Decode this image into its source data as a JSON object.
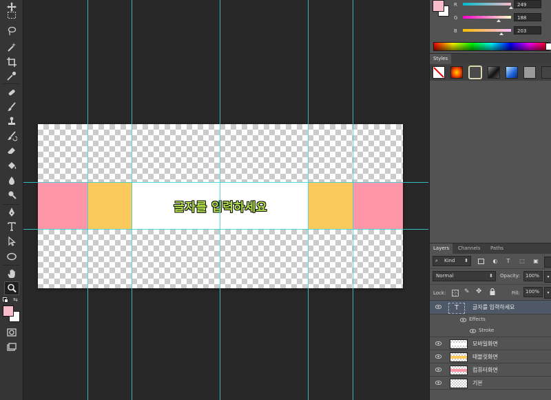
{
  "toolbar": {
    "tools": [
      "move-tool",
      "marquee-tool",
      "lasso-tool",
      "magic-wand-tool",
      "crop-tool",
      "eyedropper-tool",
      "spot-healing-tool",
      "brush-tool",
      "clone-stamp-tool",
      "history-brush-tool",
      "eraser-tool",
      "paint-bucket-tool",
      "blur-tool",
      "dodge-tool",
      "pen-tool",
      "type-tool",
      "path-selection-tool",
      "ellipse-tool",
      "hand-tool",
      "zoom-tool"
    ],
    "active_tool": "zoom-tool",
    "foreground_color": "#f9bccb",
    "background_color": "#ffffff"
  },
  "canvas": {
    "banner_text": "글자를 입력하세요",
    "band_colors": {
      "pink": "#fd96a9",
      "yellow": "#fcc95c",
      "white": "#ffffff"
    }
  },
  "color_panel": {
    "foreground_color": "#f9bccb",
    "channels": [
      {
        "label": "R",
        "value": "249"
      },
      {
        "label": "G",
        "value": "188"
      },
      {
        "label": "B",
        "value": "203"
      }
    ]
  },
  "styles_panel": {
    "tab": "Styles",
    "swatches": [
      "no-style",
      "red-glow",
      "cream-bevel",
      "dark-chrome",
      "blue-glass",
      "gray-flat",
      "dark-gray"
    ]
  },
  "layers_panel": {
    "tabs": [
      "Layers",
      "Channels",
      "Paths"
    ],
    "active_tab": "Layers",
    "filter_kind": "Kind",
    "blend_mode": "Normal",
    "opacity_label": "Opacity:",
    "opacity_value": "100%",
    "lock_label": "Lock:",
    "fill_label": "Fill:",
    "fill_value": "100%",
    "layers": [
      {
        "name": "글자를 입력하세요",
        "type": "text",
        "selected": true,
        "effects": {
          "label": "Effects",
          "items": [
            "Stroke"
          ]
        }
      },
      {
        "name": "모바일화면",
        "type": "pixel",
        "thumb_stripe": "#ffffff"
      },
      {
        "name": "태블릿화면",
        "type": "pixel",
        "thumb_stripe": "#fcc95c"
      },
      {
        "name": "컴퓨터화면",
        "type": "pixel",
        "thumb_stripe": "#fd96a9"
      },
      {
        "name": "기본",
        "type": "pixel",
        "thumb_stripe": ""
      }
    ]
  }
}
